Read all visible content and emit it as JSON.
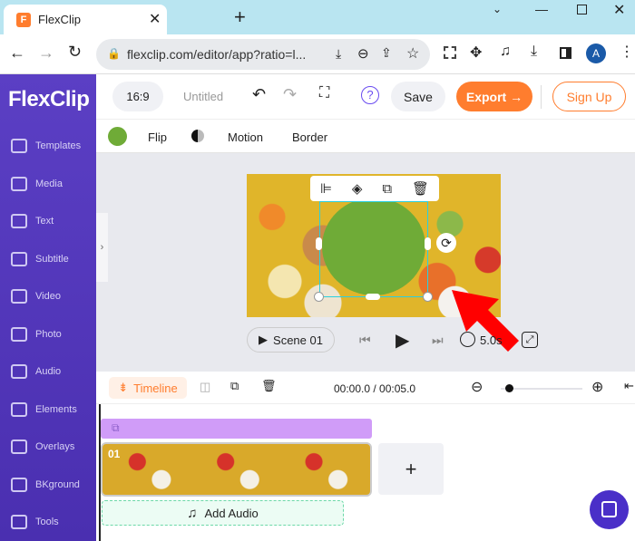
{
  "browser": {
    "tab_title": "FlexClip",
    "url": "flexclip.com/editor/app?ratio=l...",
    "avatar": "A"
  },
  "app": {
    "logo": "FlexClip",
    "ratio": "16:9",
    "project_name": "Untitled",
    "save": "Save",
    "export": "Export →",
    "signup": "Sign Up",
    "help": "?"
  },
  "sidebar": {
    "items": [
      {
        "label": "Templates"
      },
      {
        "label": "Media"
      },
      {
        "label": "Text"
      },
      {
        "label": "Subtitle"
      },
      {
        "label": "Video"
      },
      {
        "label": "Photo"
      },
      {
        "label": "Audio"
      },
      {
        "label": "Elements"
      },
      {
        "label": "Overlays"
      },
      {
        "label": "BKground"
      },
      {
        "label": "Tools"
      }
    ]
  },
  "toolbar": {
    "color": "#6fab37",
    "flip": "Flip",
    "motion": "Motion",
    "border": "Border"
  },
  "player": {
    "scene": "Scene 01",
    "duration": "5.0s"
  },
  "timeline": {
    "label": "Timeline",
    "time": "00:00.0 / 00:05.0",
    "clip_number": "01",
    "add_audio": "Add Audio",
    "zoom_level": 0.05
  },
  "colors": {
    "accent": "#ff7d2e",
    "sidebar": "#5b3fc4",
    "arrow": "#ff0000"
  }
}
